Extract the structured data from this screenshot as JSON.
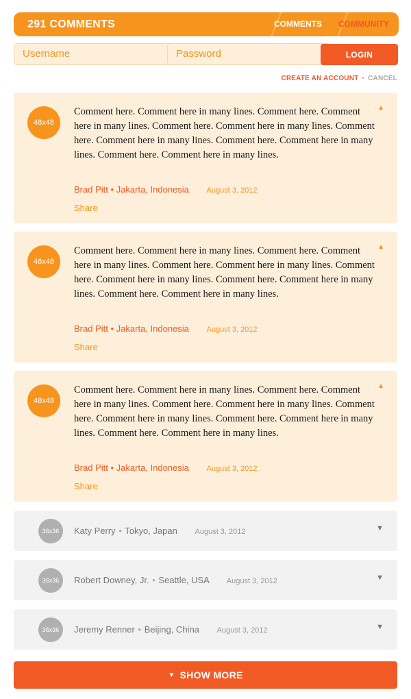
{
  "header": {
    "count_label": "291 COMMENTS",
    "tabs": [
      {
        "label": "COMMENTS"
      },
      {
        "label": "COMMUNITY"
      }
    ]
  },
  "login": {
    "username_placeholder": "Username",
    "password_placeholder": "Password",
    "login_label": "LOGIN",
    "create_account_label": "CREATE AN ACCOUNT",
    "separator": "•",
    "cancel_label": "CANCEL"
  },
  "comments": [
    {
      "avatar_label": "48x48",
      "text": "Comment here. Comment here in many lines. Comment here. Comment here in many lines. Comment here. Comment here in many lines. Comment here. Comment here in many lines. Comment here. Comment here in many lines. Comment here. Comment here in many lines.",
      "author": "Brad Pitt",
      "bullet": "•",
      "location": "Jakarta, Indonesia",
      "date": "August 3, 2012",
      "share_label": "Share",
      "arrow": "▲"
    },
    {
      "avatar_label": "48x48",
      "text": "Comment here. Comment here in many lines. Comment here. Comment here in many lines. Comment here. Comment here in many lines. Comment here. Comment here in many lines. Comment here. Comment here in many lines. Comment here. Comment here in many lines.",
      "author": "Brad Pitt",
      "bullet": "•",
      "location": "Jakarta, Indonesia",
      "date": "August 3, 2012",
      "share_label": "Share",
      "arrow": "▲"
    },
    {
      "avatar_label": "48x48",
      "text": "Comment here. Comment here in many lines. Comment here. Comment here in many lines. Comment here. Comment here in many lines. Comment here. Comment here in many lines. Comment here. Comment here in many lines. Comment here. Comment here in many lines.",
      "author": "Brad Pitt",
      "bullet": "•",
      "location": "Jakarta, Indonesia",
      "date": "August 3, 2012",
      "share_label": "Share",
      "arrow": "▲"
    }
  ],
  "collapsed": [
    {
      "avatar_label": "36x36",
      "author": "Katy Perry",
      "bullet": "•",
      "location": "Tokyo, Japan",
      "date": "August 3, 2012",
      "arrow": "▼"
    },
    {
      "avatar_label": "36x36",
      "author": "Robert Downey, Jr.",
      "bullet": "•",
      "location": "Seattle, USA",
      "date": "August 3, 2012",
      "arrow": "▼"
    },
    {
      "avatar_label": "36x36",
      "author": "Jeremy Renner",
      "bullet": "•",
      "location": "Beijing, China",
      "date": "August 3, 2012",
      "arrow": "▼"
    }
  ],
  "show_more": {
    "arrow": "▼",
    "label": "SHOW MORE"
  },
  "colors": {
    "orange": "#f7941d",
    "red_orange": "#f15a24",
    "cream": "#fdefda",
    "gray_panel": "#f2f2f2",
    "gray_avatar": "#b0b0b0"
  }
}
